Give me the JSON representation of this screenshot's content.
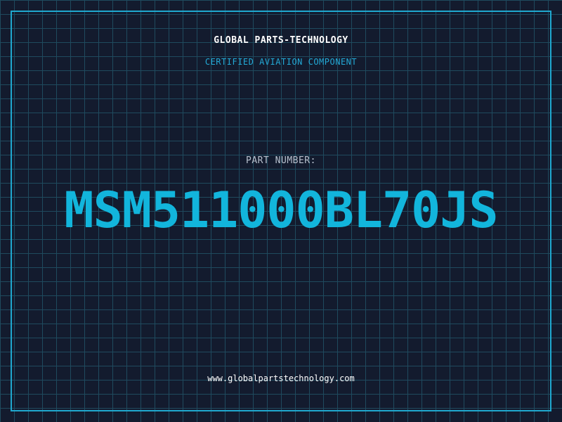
{
  "header": {
    "company": "GLOBAL PARTS-TECHNOLOGY",
    "subtitle": "CERTIFIED AVIATION COMPONENT"
  },
  "part": {
    "label": "PART NUMBER:",
    "number": "MSM511000BL70JS"
  },
  "footer": {
    "website": "www.globalpartstechnology.com"
  },
  "colors": {
    "background": "#131b2e",
    "grid": "#1f4a5e",
    "accent": "#12b5dc",
    "frame": "#1fa8cf",
    "label": "#b8c2cf",
    "text": "#ffffff"
  }
}
